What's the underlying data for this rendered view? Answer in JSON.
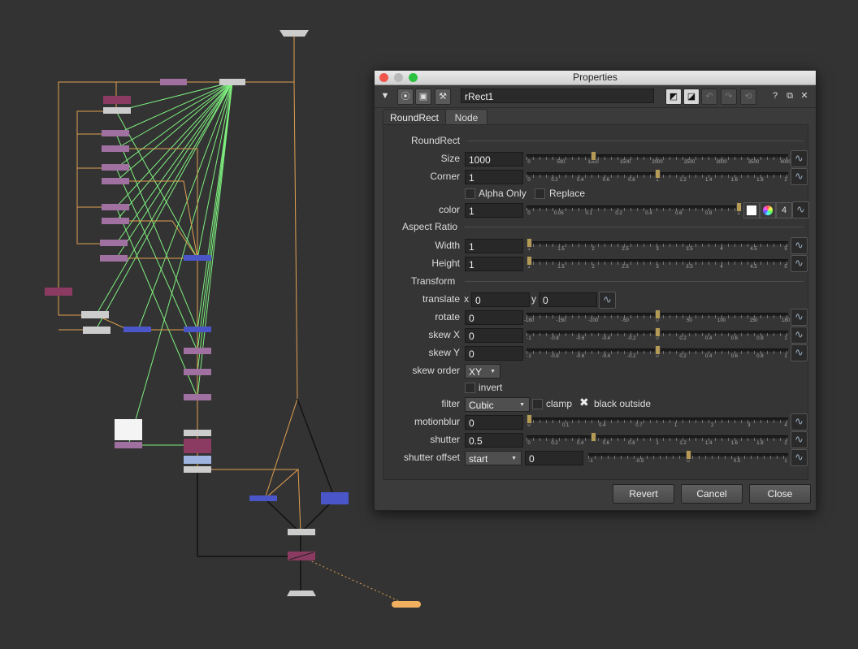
{
  "window": {
    "title": "Properties",
    "node_name": "rRect1"
  },
  "tabs": [
    "RoundRect",
    "Node"
  ],
  "sections": {
    "main": "RoundRect",
    "aspect": "Aspect Ratio",
    "transform": "Transform"
  },
  "fields": {
    "size": {
      "label": "Size",
      "value": "1000",
      "ticks": [
        "0",
        "500",
        "1000",
        "1500",
        "2000",
        "2500",
        "3000",
        "3500",
        "4000"
      ],
      "fraction": 0.25
    },
    "corner": {
      "label": "Corner",
      "value": "1",
      "ticks": [
        "0",
        "0.2",
        "0.4",
        "0.6",
        "0.8",
        "1",
        "1.2",
        "1.4",
        "1.6",
        "1.8",
        "2"
      ],
      "fraction": 0.5
    },
    "color": {
      "label": "color",
      "value": "1",
      "ticks": [
        "0",
        "0.05",
        "0.1",
        "0.2",
        "0.4",
        "0.6",
        "0.8",
        "1"
      ],
      "fraction": 1.0,
      "channels": "4"
    },
    "width": {
      "label": "Width",
      "value": "1",
      "ticks": [
        "1",
        "1.5",
        "2",
        "2.5",
        "3",
        "3.5",
        "4",
        "4.5",
        "5"
      ],
      "fraction": 0.0
    },
    "height": {
      "label": "Height",
      "value": "1",
      "ticks": [
        "1",
        "1.5",
        "2",
        "2.5",
        "3",
        "3.5",
        "4",
        "4.5",
        "5"
      ],
      "fraction": 0.0
    },
    "translate": {
      "label": "translate",
      "x_label": "x",
      "x": "0",
      "y_label": "y",
      "y": "0"
    },
    "rotate": {
      "label": "rotate",
      "value": "0",
      "ticks": [
        "-180",
        "-150",
        "-100",
        "-50",
        "0",
        "50",
        "100",
        "150",
        "180"
      ],
      "fraction": 0.5
    },
    "skewx": {
      "label": "skew X",
      "value": "0",
      "ticks": [
        "-1",
        "-0.8",
        "-0.6",
        "-0.4",
        "-0.2",
        "0",
        "0.2",
        "0.4",
        "0.6",
        "0.8",
        "1"
      ],
      "fraction": 0.5
    },
    "skewy": {
      "label": "skew Y",
      "value": "0",
      "ticks": [
        "-1",
        "-0.8",
        "-0.6",
        "-0.4",
        "-0.2",
        "0",
        "0.2",
        "0.4",
        "0.6",
        "0.8",
        "1"
      ],
      "fraction": 0.5
    },
    "skew_order": {
      "label": "skew order",
      "value": "XY"
    },
    "filter": {
      "label": "filter",
      "value": "Cubic"
    },
    "motionblur": {
      "label": "motionblur",
      "value": "0",
      "ticks": [
        "0",
        "0.1",
        "0.4",
        "0.7",
        "1",
        "2",
        "3",
        "4"
      ],
      "fraction": 0.0
    },
    "shutter": {
      "label": "shutter",
      "value": "0.5",
      "ticks": [
        "0",
        "0.2",
        "0.4",
        "0.6",
        "0.8",
        "1",
        "1.2",
        "1.4",
        "1.6",
        "1.8",
        "2"
      ],
      "fraction": 0.25
    },
    "shutter_offset": {
      "label": "shutter offset",
      "mode": "start",
      "value": "0",
      "ticks": [
        "-1",
        "-0.5",
        "0",
        "0.5",
        "1"
      ],
      "fraction": 0.5
    }
  },
  "checkboxes": {
    "alpha_only": "Alpha Only",
    "replace": "Replace",
    "invert": "invert",
    "clamp": "clamp",
    "black_outside": "black outside"
  },
  "buttons": {
    "revert": "Revert",
    "cancel": "Cancel",
    "close": "Close"
  },
  "colors": {
    "accent": "#b59a55",
    "node_purple": "#a070a0",
    "node_blue": "#4a55c8",
    "node_merge": "#8b3a62",
    "link_green": "#7ef07e",
    "link_orange": "#e0a050",
    "viewer_orange": "#f0b060"
  }
}
